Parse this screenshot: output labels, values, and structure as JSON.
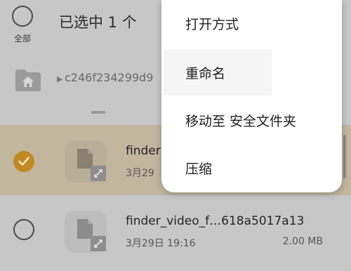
{
  "header": {
    "select_all_label": "全部",
    "selected_count": "已选中 1 个"
  },
  "path": {
    "text": "c246f234299d9"
  },
  "files": [
    {
      "name": "finder",
      "date": "3月29",
      "size": "",
      "selected": true
    },
    {
      "name": "finder_video_f…618a5017a13",
      "date": "3月29日 19:16",
      "size": "2.00 MB",
      "selected": false
    }
  ],
  "menu": {
    "items": [
      {
        "label": "打开方式"
      },
      {
        "label": "重命名"
      },
      {
        "label": "移动至 安全文件夹"
      },
      {
        "label": "压缩"
      }
    ]
  },
  "colors": {
    "selected_check": "#c08a23",
    "selected_row": "#c2b69f",
    "menu_bg": "#ffffff",
    "dim_bg": "#c7c7c7"
  }
}
